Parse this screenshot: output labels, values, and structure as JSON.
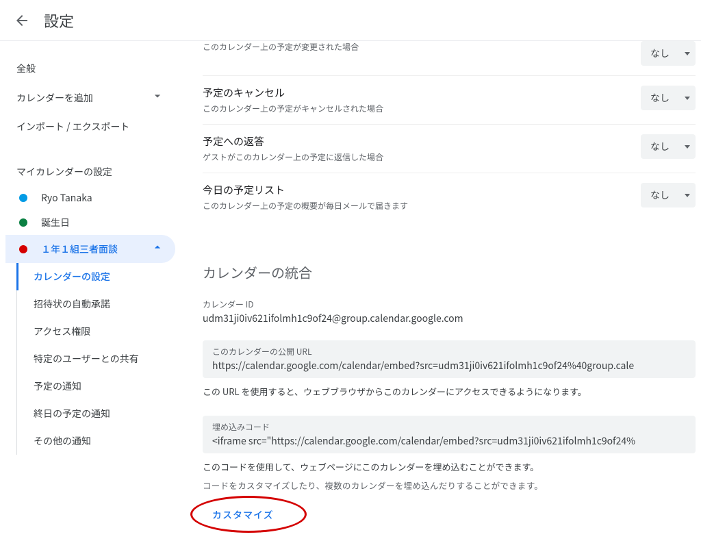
{
  "header": {
    "title": "設定"
  },
  "sidebar": {
    "general": "全般",
    "add_calendar": "カレンダーを追加",
    "import_export": "インポート / エクスポート",
    "my_cal_settings": "マイカレンダーの設定",
    "calendars": [
      {
        "label": "Ryo Tanaka",
        "color": "#039be5"
      },
      {
        "label": "誕生日",
        "color": "#0b8043"
      },
      {
        "label": "１年１組三者面談",
        "color": "#d50000"
      }
    ],
    "subitems": [
      "カレンダーの設定",
      "招待状の自動承諾",
      "アクセス権限",
      "特定のユーザーとの共有",
      "予定の通知",
      "終日の予定の通知",
      "その他の通知"
    ]
  },
  "main": {
    "rows": [
      {
        "label_hidden": "",
        "desc": "このカレンダー上の予定が変更された場合",
        "value": "なし"
      },
      {
        "label": "予定のキャンセル",
        "desc": "このカレンダー上の予定がキャンセルされた場合",
        "value": "なし"
      },
      {
        "label": "予定への返答",
        "desc": "ゲストがこのカレンダー上の予定に返信した場合",
        "value": "なし"
      },
      {
        "label": "今日の予定リスト",
        "desc": "このカレンダー上の予定の概要が毎日メールで届きます",
        "value": "なし"
      }
    ],
    "integration_heading": "カレンダーの統合",
    "cal_id_label": "カレンダー ID",
    "cal_id_value": "udm31ji0iv621ifolmh1c9of24@group.calendar.google.com",
    "public_url_label": "このカレンダーの公開 URL",
    "public_url_value": "https://calendar.google.com/calendar/embed?src=udm31ji0iv621ifolmh1c9of24%40group.cale",
    "public_url_note": "この URL を使用すると、ウェブブラウザからこのカレンダーにアクセスできるようになります。",
    "embed_label": "埋め込みコード",
    "embed_value": "<iframe src=\"https://calendar.google.com/calendar/embed?src=udm31ji0iv621ifolmh1c9of24%",
    "embed_note1": "このコードを使用して、ウェブページにこのカレンダーを埋め込むことができます。",
    "embed_note2": "コードをカスタマイズしたり、複数のカレンダーを埋め込んだりすることができます。",
    "customize_btn": "カスタマイズ"
  }
}
